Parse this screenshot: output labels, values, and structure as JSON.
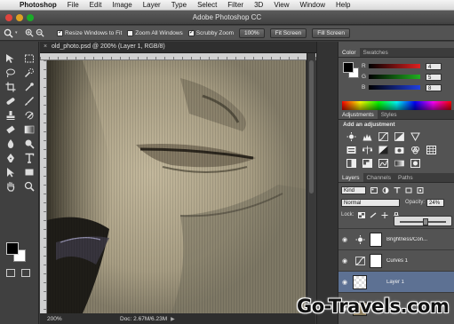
{
  "menubar": {
    "apple": "",
    "items": [
      "Photoshop",
      "File",
      "Edit",
      "Image",
      "Layer",
      "Type",
      "Select",
      "Filter",
      "3D",
      "View",
      "Window",
      "Help"
    ]
  },
  "window": {
    "title": "Adobe Photoshop CC"
  },
  "options": {
    "resize_label": "Resize Windows to Fit",
    "zoom_all_label": "Zoom All Windows",
    "scrubby_label": "Scrubby Zoom",
    "btn_100": "100%",
    "btn_fit": "Fit Screen",
    "btn_fill": "Fill Screen"
  },
  "document": {
    "tab": "old_photo.psd @ 200% (Layer 1, RGB/8)",
    "tab_close": "×",
    "zoom": "200%",
    "doc_size": "Doc: 2.67M/6.23M",
    "status_arrow": "▶"
  },
  "color_panel": {
    "tabs": [
      "Color",
      "Swatches"
    ],
    "rows": [
      {
        "label": "R",
        "value": "4",
        "color": "#e02020"
      },
      {
        "label": "G",
        "value": "5",
        "color": "#20b020"
      },
      {
        "label": "B",
        "value": "8",
        "color": "#2040e0"
      }
    ]
  },
  "adjustments_panel": {
    "tabs": [
      "Adjustments",
      "Styles"
    ],
    "title": "Add an adjustment"
  },
  "layers_panel": {
    "tabs": [
      "Layers",
      "Channels",
      "Paths"
    ],
    "kind": "Kind",
    "blend_mode": "Normal",
    "opacity_label": "Opacity:",
    "opacity_value": "24%",
    "lock_label": "Lock:",
    "fill_slider_fraction": 0.56,
    "layers": [
      {
        "name": "Brightness/Con...",
        "selected": false
      },
      {
        "name": "Curves 1",
        "selected": false
      },
      {
        "name": "Layer 1",
        "selected": true
      }
    ]
  },
  "watermark": "Go-Travels.com"
}
